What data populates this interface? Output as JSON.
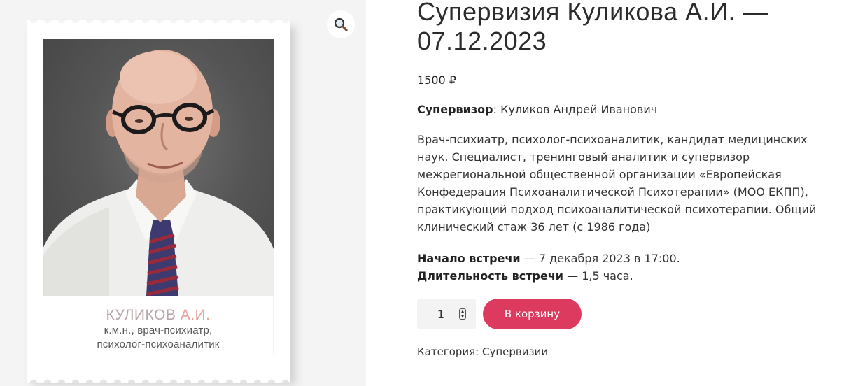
{
  "product": {
    "title": "Супервизия Куликова А.И. — 07.12.2023",
    "price": "1500 ₽",
    "supervisor_label": "Супервизор",
    "supervisor_value": ": Куликов Андрей Иванович",
    "description": "Врач-психиатр, психолог-психоаналитик, кандидат медицинских наук. Специалист, тренинговый аналитик и супервизор межрегиональной общественной организации «Европейская Конфедерация Психоаналитической Психотерапии» (МОО ЕКПП), практикующий подход психоаналитической психотерапии. Общий клинический стаж 36 лет (с 1986 года)",
    "start_label": "Начало встречи",
    "start_value": " — 7 декабря 2023 в 17:00.",
    "duration_label": "Длительность встречи",
    "duration_value": " — 1,5 часа.",
    "quantity": "1",
    "add_to_cart_label": "В корзину",
    "category_label": "Категория: ",
    "category_value": "Супервизии"
  },
  "gallery": {
    "zoom_icon": "magnifier-icon",
    "caption_name_part1": "КУЛИКОВ ",
    "caption_name_part2": "А.И.",
    "caption_line1": "к.м.н., врач-психиатр,",
    "caption_line2": "психолог-психоаналитик"
  },
  "colors": {
    "accent": "#dc3a5e",
    "caption_name": "#b7a5a8",
    "caption_initials": "#e8a39b"
  }
}
